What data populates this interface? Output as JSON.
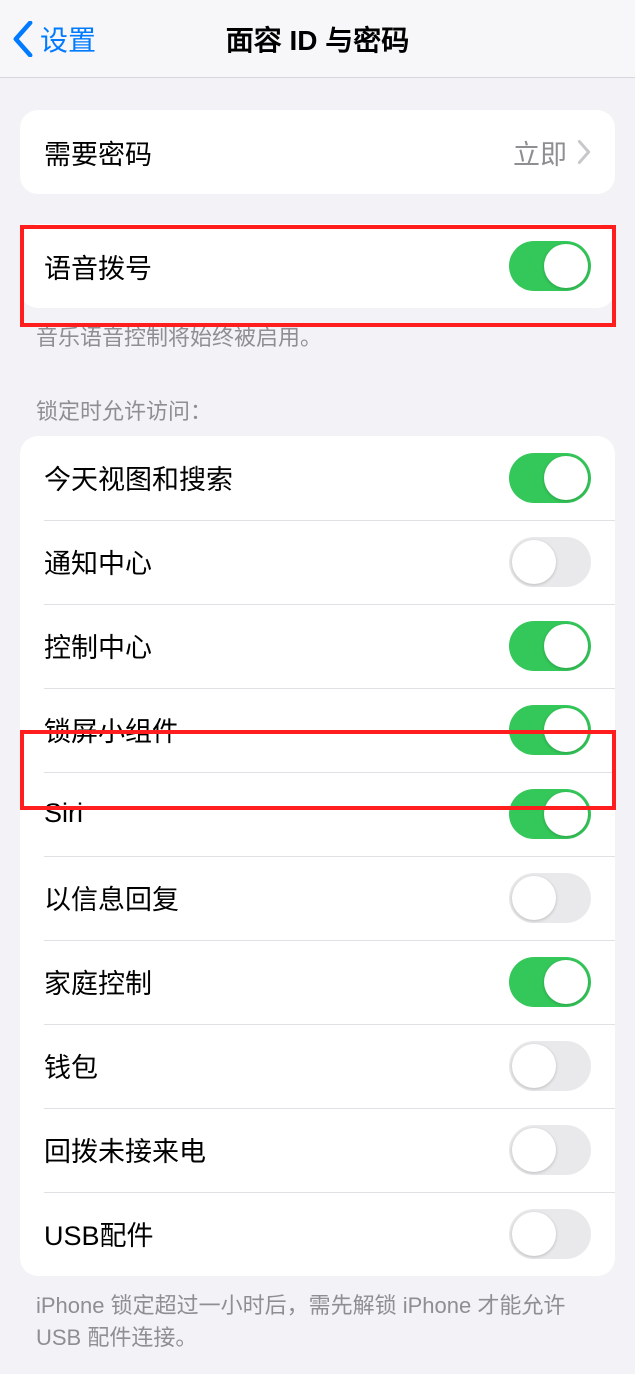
{
  "nav": {
    "back": "设置",
    "title": "面容 ID 与密码"
  },
  "passcode_row": {
    "label": "需要密码",
    "value": "立即"
  },
  "voice_dial": {
    "label": "语音拨号",
    "footnote": "音乐语音控制将始终被启用。"
  },
  "lock_access": {
    "header": "锁定时允许访问：",
    "items": [
      {
        "label": "今天视图和搜索",
        "on": true
      },
      {
        "label": "通知中心",
        "on": false
      },
      {
        "label": "控制中心",
        "on": true
      },
      {
        "label": "锁屏小组件",
        "on": true
      },
      {
        "label": "Siri",
        "on": true
      },
      {
        "label": "以信息回复",
        "on": false
      },
      {
        "label": "家庭控制",
        "on": true
      },
      {
        "label": "钱包",
        "on": false
      },
      {
        "label": "回拨未接来电",
        "on": false
      },
      {
        "label": "USB配件",
        "on": false
      }
    ],
    "footnote": "iPhone 锁定超过一小时后，需先解锁 iPhone 才能允许USB 配件连接。"
  }
}
